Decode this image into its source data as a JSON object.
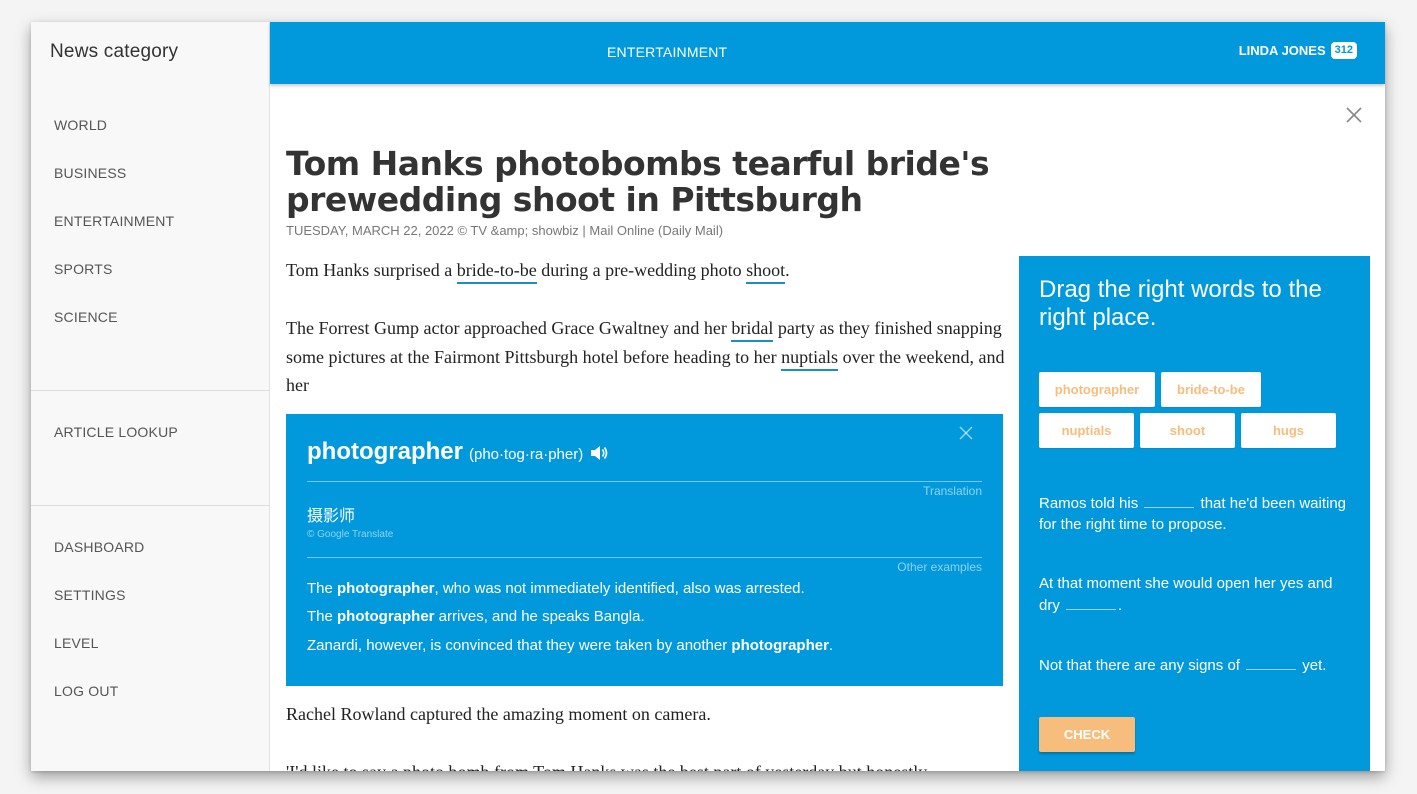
{
  "sidebar": {
    "title": "News category",
    "categories": [
      {
        "label": "WORLD"
      },
      {
        "label": "BUSINESS"
      },
      {
        "label": "ENTERTAINMENT"
      },
      {
        "label": "SPORTS"
      },
      {
        "label": "SCIENCE"
      }
    ],
    "tools": [
      {
        "label": "ARTICLE LOOKUP"
      }
    ],
    "account": [
      {
        "label": "DASHBOARD"
      },
      {
        "label": "SETTINGS"
      },
      {
        "label": "LEVEL"
      },
      {
        "label": "LOG OUT"
      }
    ]
  },
  "header": {
    "category": "ENTERTAINMENT",
    "user_name": "LINDA JONES",
    "user_points": "312"
  },
  "article": {
    "title": "Tom Hanks photobombs tearful bride's prewedding shoot in Pittsburgh",
    "meta": "TUESDAY, MARCH 22, 2022 © TV &amp; showbiz | Mail Online (Daily Mail)",
    "p1": {
      "a": "Tom Hanks surprised a ",
      "w1": "bride-to-be",
      "b": " during a pre-wedding photo ",
      "w2": "shoot",
      "c": "."
    },
    "p2": {
      "a": "The Forrest Gump actor approached Grace Gwaltney and her ",
      "w1": "bridal",
      "b": " party as they finished snapping some pictures at the Fairmont Pittsburgh hotel before heading to her ",
      "w2": "nuptials",
      "c": " over the weekend, and her "
    },
    "p3": "Rachel Rowland captured the amazing moment on camera.",
    "p4": "'I'd like to say a photo bomb from Tom Hanks was the best part of yesterday but honestly"
  },
  "dictionary": {
    "word": "photographer",
    "pronunciation": "(pho·tog·ra·pher)",
    "translation_label": "Translation",
    "translation": "摄影师",
    "credit": "© Google Translate",
    "examples_label": "Other examples",
    "examples": [
      {
        "pre": "The ",
        "bold": "photographer",
        "post": ", who was not immediately identified, also was arrested."
      },
      {
        "pre": "The ",
        "bold": "photographer",
        "post": " arrives, and he speaks Bangla."
      },
      {
        "pre": "Zanardi, however, is convinced that they were taken by another ",
        "bold": "photographer",
        "post": "."
      }
    ]
  },
  "exercise": {
    "title": "Drag the right words to the right place.",
    "words": [
      "photographer",
      "bride-to-be",
      "nuptials",
      "shoot",
      "hugs"
    ],
    "sentences": [
      {
        "pre": "Ramos told his ",
        "post": " that he'd been waiting for the right time to propose."
      },
      {
        "pre": "At that moment she would open her yes and dry ",
        "post": "."
      },
      {
        "pre": "Not that there are any signs of ",
        "post": " yet."
      }
    ],
    "check_label": "CHECK"
  },
  "colors": {
    "accent": "#0299dc",
    "chip_text": "#f6bd7c",
    "check_button": "#f6bd7c"
  }
}
